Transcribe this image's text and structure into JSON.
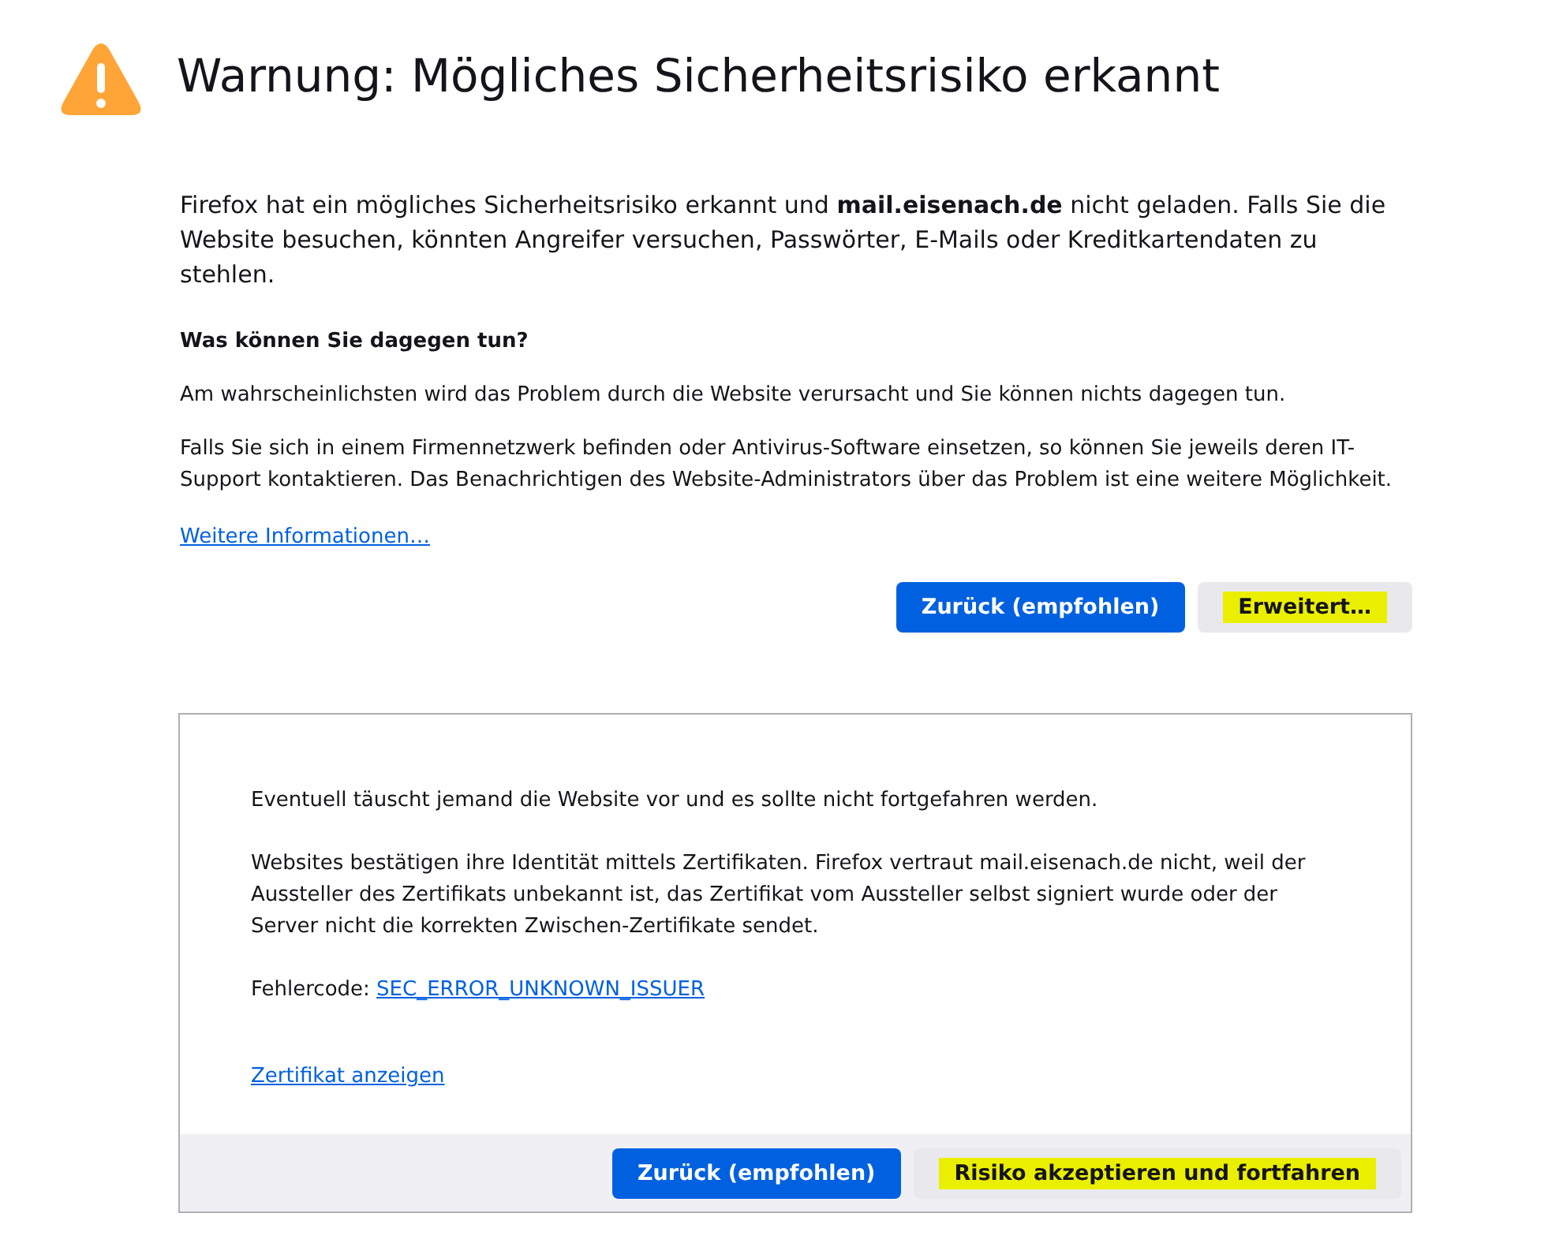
{
  "title": "Warnung: Mögliches Sicherheitsrisiko erkannt",
  "intro": "Firefox hat ein mögliches Sicherheitsrisiko erkannt und **mail.eisenach.de** nicht geladen. Falls Sie die Website besuchen, könnten Angreifer versuchen, Passwörter, E-Mails oder Kreditkartendaten zu stehlen.",
  "what_heading": "Was können Sie dagegen tun?",
  "paragraphs": [
    "Am wahrscheinlichsten wird das Problem durch die Website verursacht und Sie können nichts dagegen tun.",
    "Falls Sie sich in einem Firmennetzwerk befinden oder Antivirus-Software einsetzen, so können Sie jeweils deren IT-Support kontaktieren. Das Benachrichtigen des Website-Administrators über das Problem ist eine weitere Möglichkeit."
  ],
  "more_link": "Weitere Informationen…",
  "buttons": [
    {
      "label": "Zurück (empfohlen)",
      "kind": "primary",
      "highlighted": false
    },
    {
      "label": "Erweitert…",
      "kind": "secondary",
      "highlighted": true
    }
  ],
  "advanced_panel": {
    "paragraphs": [
      "Eventuell täuscht jemand die Website vor und es sollte nicht fortgefahren werden.",
      "Websites bestätigen ihre Identität mittels Zertifikaten. Firefox vertraut mail.eisenach.de nicht, weil der Aussteller des Zertifikats unbekannt ist, das Zertifikat vom Aussteller selbst signiert wurde oder der Server nicht die korrekten Zwischen-Zertifikate sendet."
    ],
    "error_label": "Fehlercode:",
    "error_code": "SEC_ERROR_UNKNOWN_ISSUER",
    "certificate_link": "Zertifikat anzeigen",
    "buttons": [
      {
        "label": "Zurück (empfohlen)",
        "kind": "primary",
        "highlighted": false
      },
      {
        "label": "Risiko akzeptieren und fortfahren",
        "kind": "secondary",
        "highlighted": true
      }
    ]
  }
}
